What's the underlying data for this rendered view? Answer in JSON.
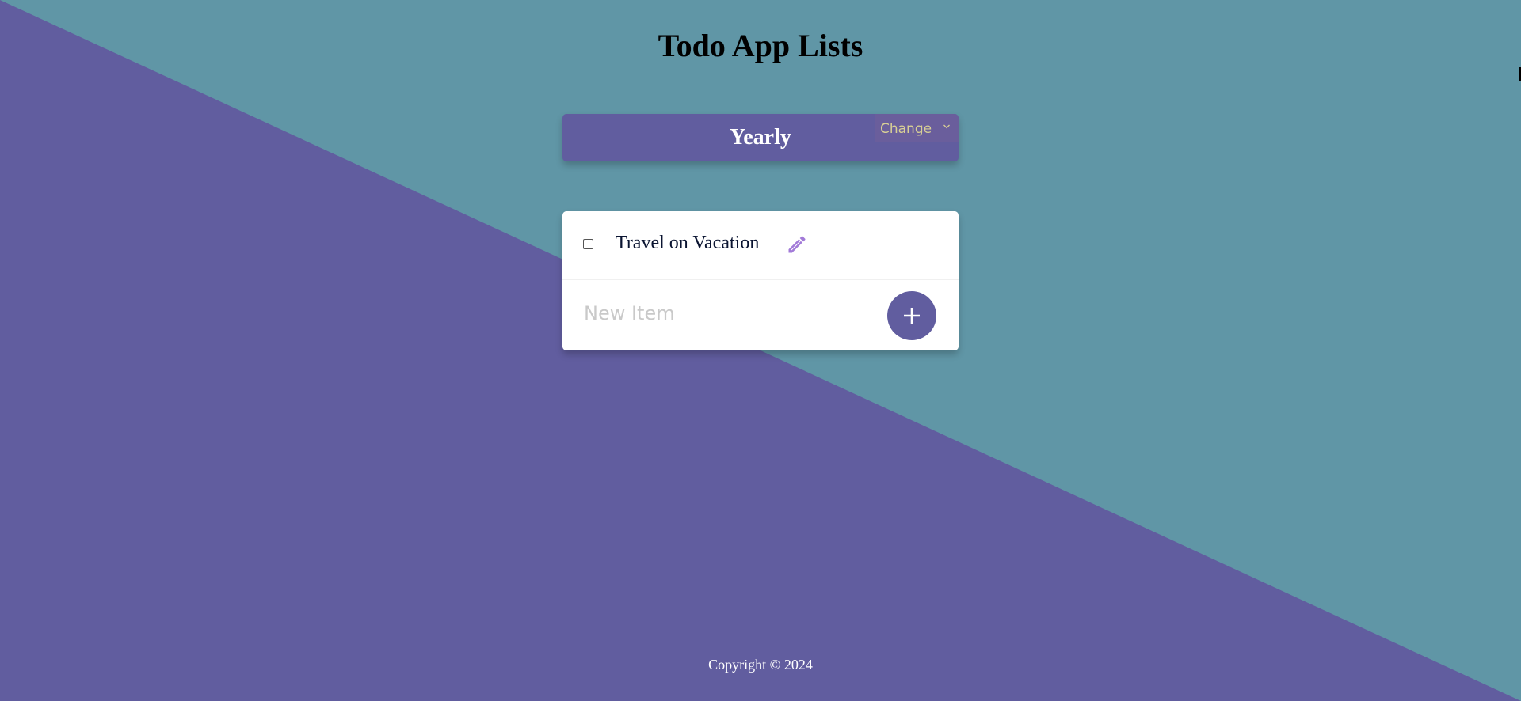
{
  "page": {
    "title": "Todo App Lists"
  },
  "list_header": {
    "title": "Yearly",
    "change_select": {
      "selected": "Change"
    }
  },
  "todo": {
    "items": [
      {
        "label": "Travel on Vacation",
        "checked": false
      }
    ],
    "new_item": {
      "value": "",
      "placeholder": "New Item"
    },
    "add_button_icon": "plus-icon",
    "edit_icon": "pencil-icon"
  },
  "footer": {
    "copyright": "Copyright © 2024"
  },
  "colors": {
    "background_teal": "#6096a6",
    "background_purple": "#615d9f",
    "accent_purple": "#615d9f",
    "edit_icon_color": "#a27ad8",
    "card_background": "#ffffff"
  }
}
